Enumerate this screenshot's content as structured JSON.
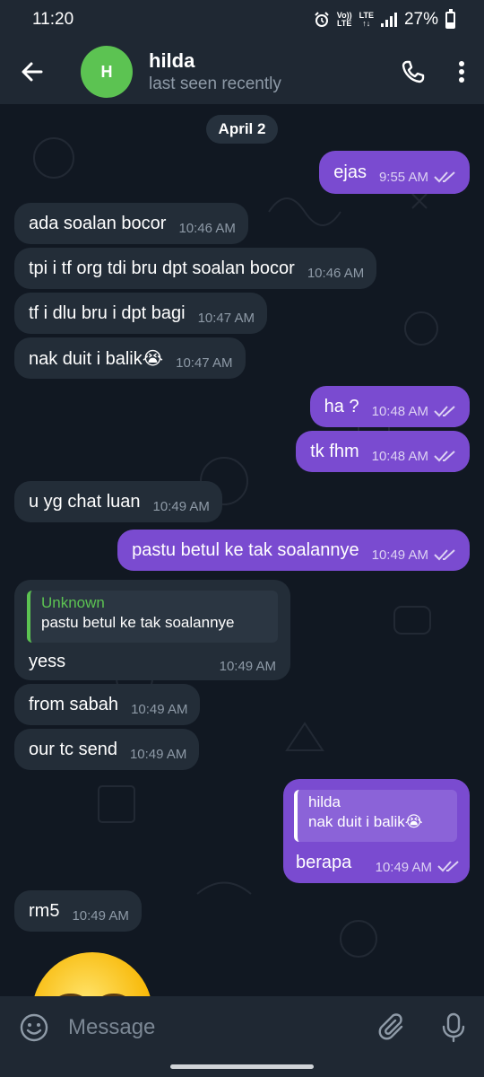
{
  "status_bar": {
    "time": "11:20",
    "network_top": "Vo))",
    "network_bottom": "LTE",
    "lte_top": "LTE",
    "lte_bottom": "LTE",
    "battery": "27%",
    "battery_level": 0.27
  },
  "header": {
    "avatar_initial": "H",
    "name": "hilda",
    "status": "last seen recently",
    "avatar_color": "#5cc352"
  },
  "chat": {
    "date": "April 2",
    "messages": [
      {
        "dir": "out",
        "text": "ejas",
        "time": "9:55 AM",
        "read": true
      },
      {
        "dir": "in",
        "text": "ada soalan bocor",
        "time": "10:46 AM"
      },
      {
        "dir": "in",
        "text": "tpi i tf org tdi bru dpt soalan bocor",
        "time": "10:46 AM"
      },
      {
        "dir": "in",
        "text": "tf i dlu bru i dpt bagi",
        "time": "10:47 AM"
      },
      {
        "dir": "in",
        "text": "nak duit i balik😭",
        "time": "10:47 AM"
      },
      {
        "dir": "out",
        "text": "ha ?",
        "time": "10:48 AM",
        "read": true
      },
      {
        "dir": "out",
        "text": "tk fhm",
        "time": "10:48 AM",
        "read": true
      },
      {
        "dir": "in",
        "text": "u yg chat luan",
        "time": "10:49 AM"
      },
      {
        "dir": "out",
        "text": "pastu betul ke tak soalannye",
        "time": "10:49 AM",
        "read": true
      },
      {
        "dir": "in",
        "text": "yess",
        "time": "10:49 AM",
        "reply_name": "Unknown",
        "reply_text": "pastu betul ke tak soalannye"
      },
      {
        "dir": "in",
        "text": "from sabah",
        "time": "10:49 AM"
      },
      {
        "dir": "in",
        "text": "our tc send",
        "time": "10:49 AM"
      },
      {
        "dir": "out",
        "text": "berapa",
        "time": "10:49 AM",
        "read": true,
        "reply_name": "hilda",
        "reply_text": "nak duit i balik😭"
      },
      {
        "dir": "in",
        "text": "rm5",
        "time": "10:49 AM"
      }
    ]
  },
  "input": {
    "placeholder": "Message"
  },
  "colors": {
    "outgoing_bubble": "#7a4bd0",
    "incoming_bubble": "#232d38",
    "background": "#111822",
    "bar": "#1f2833"
  },
  "icons": [
    "back-arrow-icon",
    "phone-icon",
    "more-vertical-icon",
    "emoji-icon",
    "attach-icon",
    "microphone-icon",
    "double-check-icon",
    "alarm-icon",
    "signal-icon",
    "battery-icon"
  ]
}
